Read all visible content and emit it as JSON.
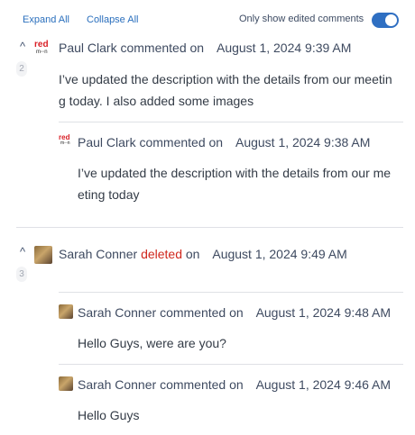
{
  "toolbar": {
    "expand_all": "Expand All",
    "collapse_all": "Collapse All",
    "toggle_label": "Only show edited comments",
    "toggle_on": true,
    "accent": "#2f6fc2"
  },
  "comments": [
    {
      "count": "2",
      "author": "Paul Clark",
      "action": "commented on",
      "date": "August 1, 2024 9:39 AM",
      "text_line1": "I’ve updated the description with the details from our meetin",
      "text_line2": "g today. I also added some images",
      "avatar_text1": "red",
      "avatar_text2": "m◦◦n",
      "reply": {
        "author": "Paul Clark",
        "action": "commented on",
        "date": "August 1, 2024 9:38 AM",
        "text_line1": "I’ve updated the description with the details from our me",
        "text_line2": "eting today"
      }
    },
    {
      "count": "3",
      "author": "Sarah Conner",
      "action": "deleted",
      "action_suffix": "on",
      "date": "August 1, 2024 9:49 AM",
      "replies": [
        {
          "author": "Sarah Conner",
          "action": "commented on",
          "date": "August 1, 2024 9:48 AM",
          "text": "Hello Guys, were are you?"
        },
        {
          "author": "Sarah Conner",
          "action": "commented on",
          "date": "August 1, 2024 9:46 AM",
          "text": "Hello Guys"
        }
      ]
    }
  ]
}
